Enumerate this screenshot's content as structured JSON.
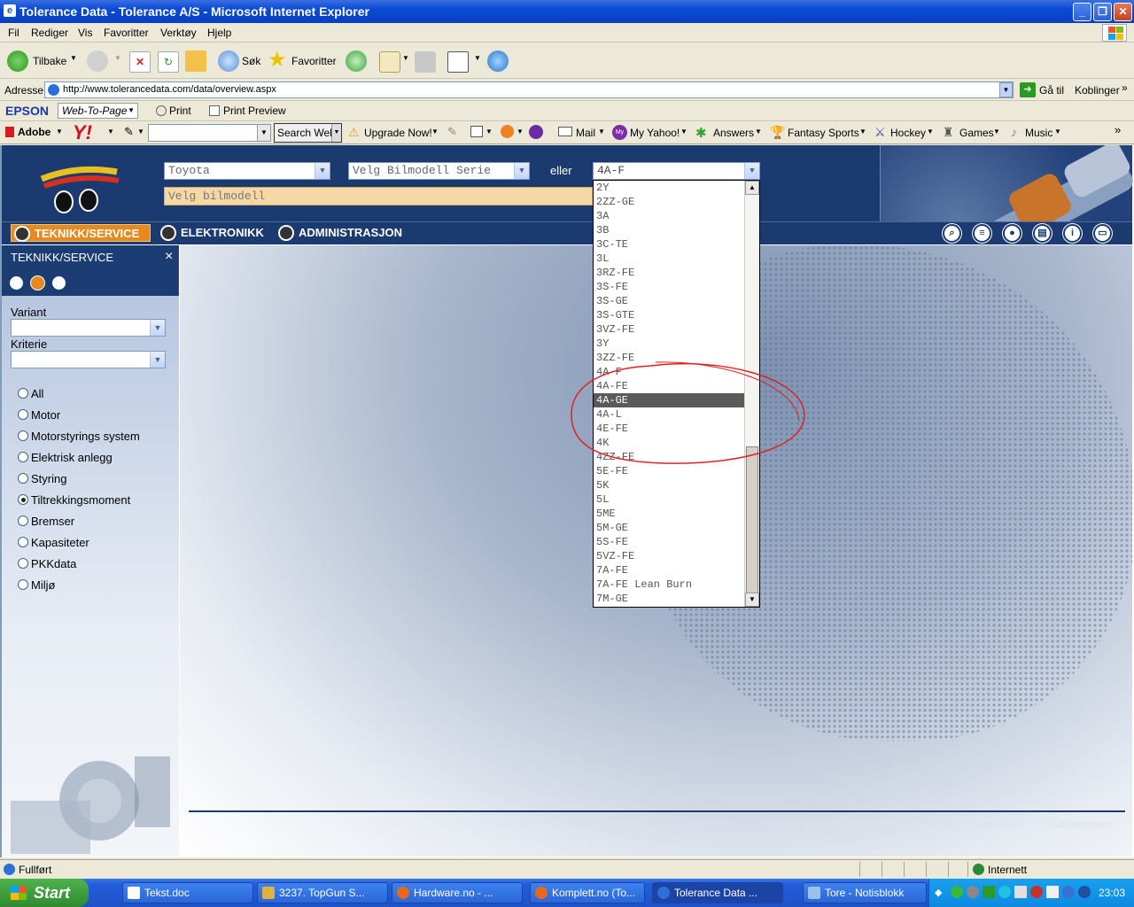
{
  "window": {
    "title": "Tolerance Data - Tolerance A/S - Microsoft Internet Explorer"
  },
  "menubar": {
    "items": [
      "Fil",
      "Rediger",
      "Vis",
      "Favoritter",
      "Verktøy",
      "Hjelp"
    ]
  },
  "toolbar": {
    "back": "Tilbake",
    "search": "Søk",
    "favorites": "Favoritter"
  },
  "address": {
    "label": "Adresse",
    "url": "http://www.tolerancedata.com/data/overview.aspx",
    "go": "Gå til",
    "links": "Koblinger"
  },
  "epson": {
    "brand": "EPSON",
    "web_to_page": "Web-To-Page",
    "print": "Print",
    "print_preview": "Print Preview"
  },
  "yahoo": {
    "adobe": "Adobe",
    "logo": "Y!",
    "search_web": "Search Web",
    "upgrade": "Upgrade Now!",
    "mail": "Mail",
    "my_yahoo": "My Yahoo!",
    "answers": "Answers",
    "fantasy": "Fantasy Sports",
    "hockey": "Hockey",
    "games": "Games",
    "music": "Music"
  },
  "header": {
    "make_select": "Toyota",
    "series_select": "Velg Bilmodell Serie",
    "or_label": "eller",
    "engine_select": "4A-F",
    "model_select": "Velg bilmodell"
  },
  "nav": {
    "tech": "TEKNIKK/SERVICE",
    "electronics": "ELEKTRONIKK",
    "admin": "ADMINISTRASJON"
  },
  "sidebar": {
    "title": "TEKNIKK/SERVICE",
    "close": "×",
    "variant_label": "Variant",
    "criteria_label": "Kriterie",
    "options": [
      "All",
      "Motor",
      "Motorstyrings system",
      "Elektrisk anlegg",
      "Styring",
      "Tiltrekkingsmoment",
      "Bremser",
      "Kapasiteter",
      "PKKdata",
      "Miljø"
    ],
    "selected": "Tiltrekkingsmoment"
  },
  "dropdown": {
    "items": [
      "2Y",
      "2ZZ-GE",
      "3A",
      "3B",
      "3C-TE",
      "3L",
      "3RZ-FE",
      "3S-FE",
      "3S-GE",
      "3S-GTE",
      "3VZ-FE",
      "3Y",
      "3ZZ-FE",
      "4A-F",
      "4A-FE",
      "4A-GE",
      "4A-L",
      "4E-FE",
      "4K",
      "4ZZ-FE",
      "5E-FE",
      "5K",
      "5L",
      "5ME",
      "5M-GE",
      "5S-FE",
      "5VZ-FE",
      "7A-FE",
      "7A-FE Lean Burn",
      "7M-GE"
    ],
    "highlighted": "4A-GE"
  },
  "footer": {
    "copyright": "© 2005 Tolerance A/S - All rights reserved",
    "legal": "Legal notis",
    "admin": "Administration"
  },
  "status": {
    "text": "Fullført",
    "zone": "Internett"
  },
  "taskbar": {
    "start": "Start",
    "tasks": [
      "Tekst.doc",
      "3237. TopGun S...",
      "Hardware.no - ...",
      "Komplett.no (To...",
      "Tolerance Data ...",
      "Tore - Notisblokk"
    ],
    "clock": "23:03"
  },
  "colors": {
    "header_bg": "#1b3a70",
    "active_tab": "#e58a1f",
    "annotation": "#e02020"
  }
}
